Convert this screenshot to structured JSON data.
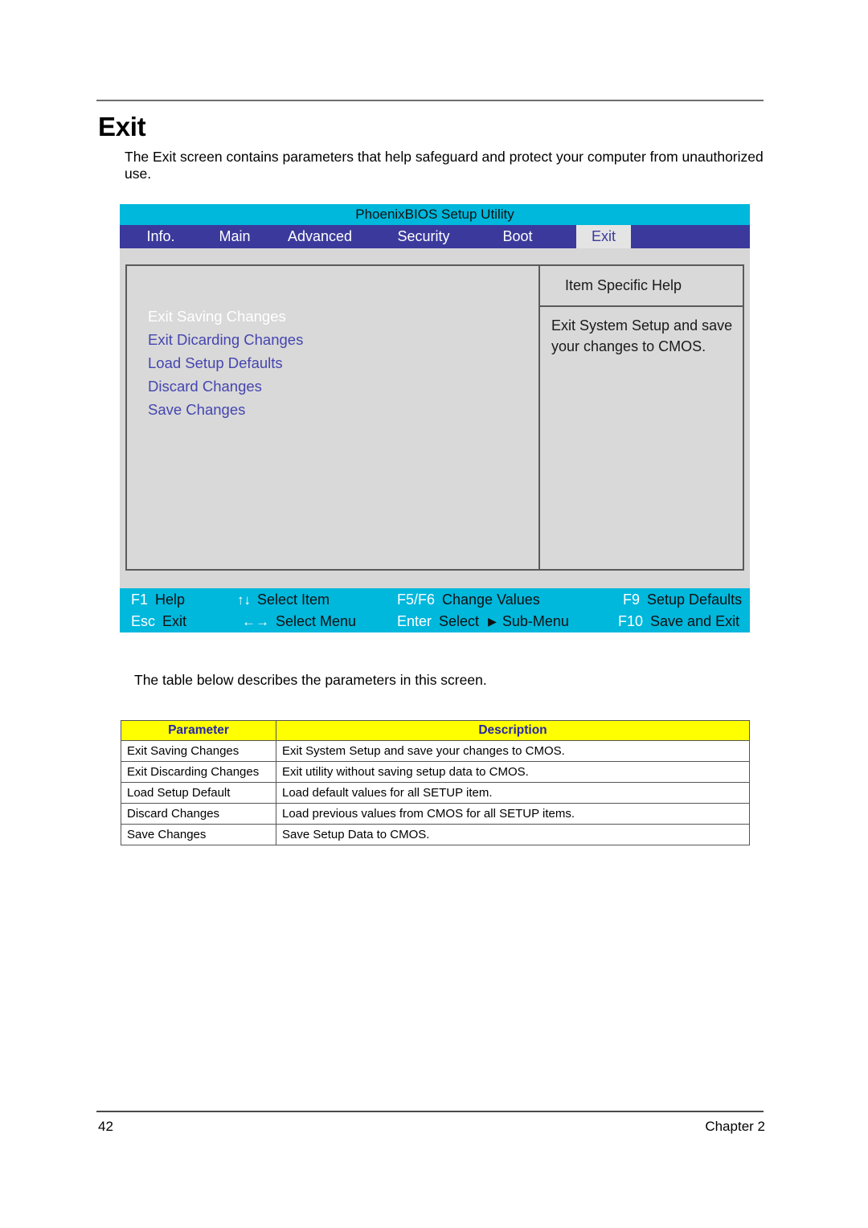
{
  "page": {
    "title": "Exit",
    "intro": "The Exit screen contains parameters that help safeguard and protect your computer from unauthorized use.",
    "table_intro": "The table below describes the parameters in this screen.",
    "page_number": "42",
    "chapter": "Chapter  2"
  },
  "bios": {
    "title": "PhoenixBIOS Setup Utility",
    "colors": {
      "titlebar": "#00b7dc",
      "tabbar": "#3b3a9c",
      "panel": "#d7d7d7",
      "selected_tab_bg": "#e4e4e4",
      "menu_text": "#4545b0",
      "highlight_text": "#ffffff"
    },
    "tabs": [
      {
        "label": "Info.",
        "selected": false
      },
      {
        "label": "Main",
        "selected": false
      },
      {
        "label": "Advanced",
        "selected": false
      },
      {
        "label": "Security",
        "selected": false
      },
      {
        "label": "Boot",
        "selected": false
      },
      {
        "label": "Exit",
        "selected": true
      }
    ],
    "menu_items": [
      {
        "label": "Exit Saving Changes",
        "highlighted": true
      },
      {
        "label": "Exit Dicarding Changes",
        "highlighted": false
      },
      {
        "label": "Load Setup Defaults",
        "highlighted": false
      },
      {
        "label": "Discard Changes",
        "highlighted": false
      },
      {
        "label": "Save Changes",
        "highlighted": false
      }
    ],
    "help": {
      "header": "Item Specific Help",
      "body": "Exit System Setup and save your changes to CMOS."
    },
    "keys_row1": [
      {
        "key": "F1",
        "label": "Help"
      },
      {
        "arrows": "↑↓",
        "label": "Select Item"
      },
      {
        "key": "F5/F6",
        "label": "Change Values"
      },
      {
        "key": "F9",
        "label": "Setup Defaults"
      }
    ],
    "keys_row2": [
      {
        "key": "Esc",
        "label": "Exit"
      },
      {
        "arrows": "←→",
        "label": "Select Menu"
      },
      {
        "key": "Enter",
        "label": "Select",
        "triangle": "▶",
        "label2": "Sub-Menu"
      },
      {
        "key": "F10",
        "label": "Save and Exit"
      }
    ]
  },
  "table": {
    "headers": [
      "Parameter",
      "Description"
    ],
    "rows": [
      [
        "Exit Saving Changes",
        "Exit System Setup and save your changes to CMOS."
      ],
      [
        "Exit Discarding Changes",
        "Exit utility without saving setup data to CMOS."
      ],
      [
        "Load Setup Default",
        "Load default values for all SETUP item."
      ],
      [
        "Discard Changes",
        "Load previous values from CMOS for all SETUP items."
      ],
      [
        "Save Changes",
        "Save Setup Data to CMOS."
      ]
    ]
  }
}
